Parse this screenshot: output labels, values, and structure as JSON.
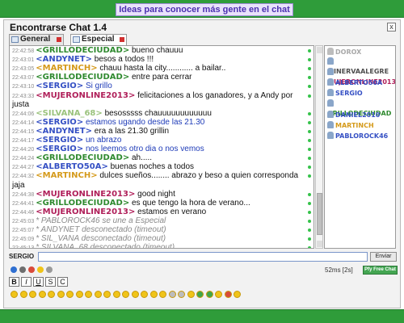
{
  "banner": {
    "text": "Ideas para conocer más gente en el chat"
  },
  "window": {
    "title": "Encontrarse Chat 1.4",
    "close_label": "x"
  },
  "tabs": [
    {
      "label": "General"
    },
    {
      "label": "Especial"
    }
  ],
  "messages": [
    {
      "ts": "22:42:58",
      "user": "GRILLODECIUDAD",
      "user_color": "#2f8a2f",
      "text": "bueno chauuu"
    },
    {
      "ts": "22:43:01",
      "user": "ANDYNET",
      "user_color": "#3550c4",
      "text": "besos a todos !!!"
    },
    {
      "ts": "22:43:05",
      "user": "MARTINCH",
      "user_color": "#d59a1b",
      "text": "chauu hasta la city............ a bailar.."
    },
    {
      "ts": "22:43:07",
      "user": "GRILLODECIUDAD",
      "user_color": "#2f8a2f",
      "text": "entre para cerrar"
    },
    {
      "ts": "22:43:10",
      "user": "SERGIO",
      "user_color": "#3550c4",
      "text": "Si grillo",
      "text_blue": true
    },
    {
      "ts": "22:43:33",
      "user": "MUJERONLINE2013",
      "user_color": "#b0205a",
      "text": "felicitaciones a los ganadores, y a Andy por justa"
    },
    {
      "ts": "22:44:06",
      "user": "SILVANA_68",
      "user_color": "#9bc37d",
      "text": "besosssss chauuuuuuuuuuuu"
    },
    {
      "ts": "22:44:14",
      "user": "SERGIO",
      "user_color": "#3550c4",
      "text": "estamos ugando desde las 21.30",
      "text_blue": true
    },
    {
      "ts": "22:44:15",
      "user": "ANDYNET",
      "user_color": "#3550c4",
      "text": "era a las 21.30 grillin"
    },
    {
      "ts": "22:44:17",
      "user": "SERGIO",
      "user_color": "#3550c4",
      "text": "un abrazo",
      "text_blue": true
    },
    {
      "ts": "22:44:20",
      "user": "SERGIO",
      "user_color": "#3550c4",
      "text": "nos leemos otro dia o nos vemos",
      "text_blue": true
    },
    {
      "ts": "22:44:24",
      "user": "GRILLODECIUDAD",
      "user_color": "#2f8a2f",
      "text": "ah....."
    },
    {
      "ts": "22:44:27",
      "user": "ALBERTO50A",
      "user_color": "#3550c4",
      "text": "buenas noches a todos"
    },
    {
      "ts": "22:44:32",
      "user": "MARTINCH",
      "user_color": "#d59a1b",
      "text": "dulces sueños........ abrazo y beso a quien corresponda jaja"
    },
    {
      "ts": "22:44:38",
      "user": "MUJERONLINE2013",
      "user_color": "#b0205a",
      "text": "good night"
    },
    {
      "ts": "22:44:41",
      "user": "GRILLODECIUDAD",
      "user_color": "#2f8a2f",
      "text": "es que tengo la hora de verano..."
    },
    {
      "ts": "22:44:46",
      "user": "MUJERONLINE2013",
      "user_color": "#b0205a",
      "text": "estamos en verano"
    },
    {
      "ts": "22:45:03",
      "system": "* PABLOROCK46 se une a Especial"
    },
    {
      "ts": "22:45:07",
      "system": "* ANDYNET desconectado (timeout)"
    },
    {
      "ts": "22:45:09",
      "system": "* SIL_VANA desconectado (timeout)"
    },
    {
      "ts": "22:45:13",
      "system": "* SILVANA_68 desconectado (timeout)"
    }
  ],
  "users": [
    {
      "name": "DOROX",
      "color": "#a8a8a8",
      "offline": true
    },
    {
      "name": "MINERVAALEGRE",
      "color": "#4e4e4e"
    },
    {
      "name": "MUJERONLINE2013",
      "color": "#b0205a"
    },
    {
      "name": "ALBERTO50A",
      "color": "#3550c4"
    },
    {
      "name": "SERGIO",
      "color": "#3550c4"
    },
    {
      "name": "GRILLODECIUDAD",
      "color": "#2f8a2f"
    },
    {
      "name": "DANIEL2010",
      "color": "#3550c4"
    },
    {
      "name": "MARTINCH",
      "color": "#d59a1b"
    },
    {
      "name": "PABLOROCK46",
      "color": "#3550c4"
    }
  ],
  "input": {
    "nick": "SERGIO",
    "value": "",
    "send_label": "Enviar"
  },
  "status": {
    "latency": "52ms [2s]",
    "pfy_label": "Pfy Free Chat"
  },
  "format_buttons": [
    "B",
    "I",
    "U",
    "S",
    "C"
  ],
  "colors": {
    "top_bar": "#2f9c3a",
    "banner_text": "#4a2fb0"
  }
}
